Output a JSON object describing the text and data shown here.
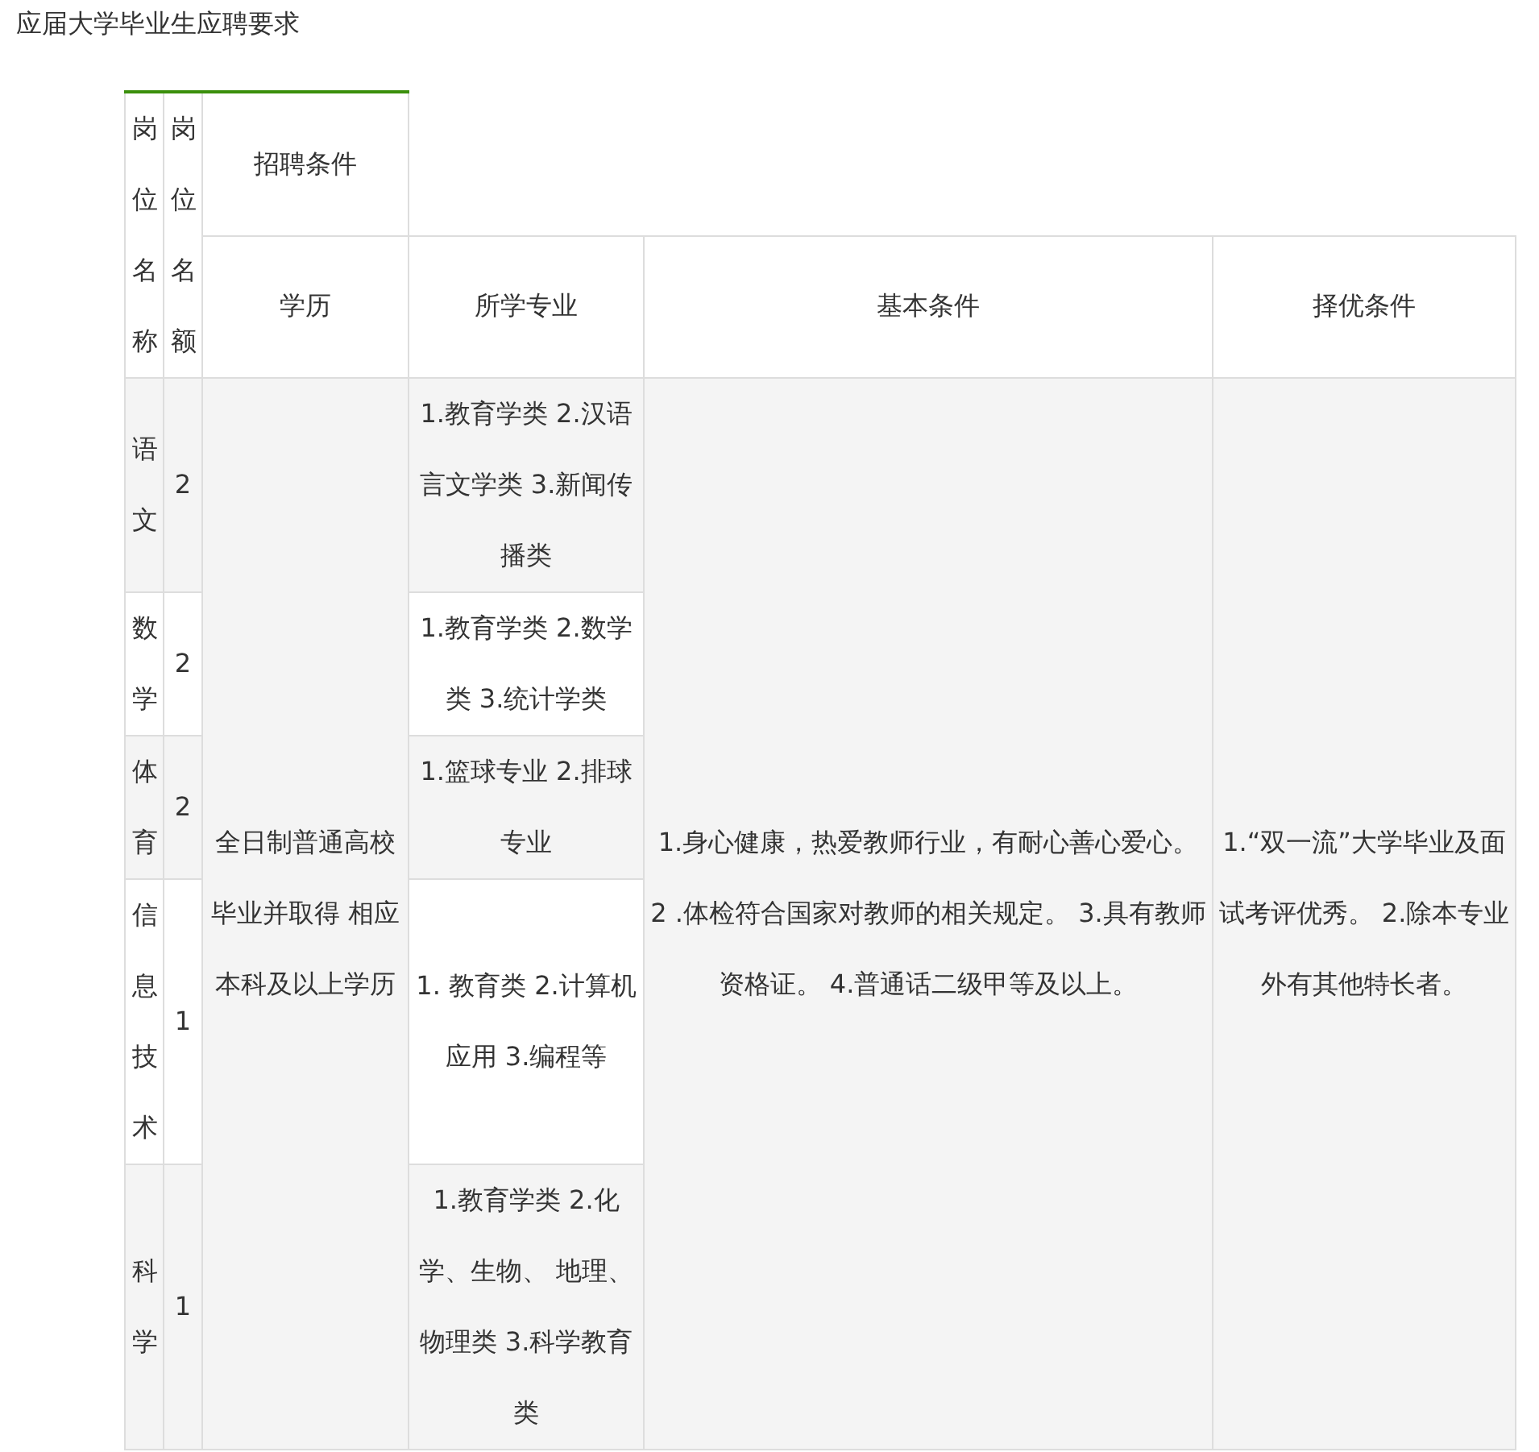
{
  "title": "应届大学毕业生应聘要求",
  "table": {
    "header": {
      "position_name": "岗位名称",
      "position_count": "岗位名额",
      "group": "招聘条件",
      "columns": [
        "学历",
        "所学专业",
        "基本条件",
        "择优条件"
      ]
    },
    "shared": {
      "education": "全日制普通高校毕业并取得 相应本科及以上学历",
      "basic": "1.身心健康，热爱教师行业，有耐心善心爱心。 2 .体检符合国家对教师的相关规定。 3.具有教师资格证。 4.普通话二级甲等及以上。",
      "preferred": "1.“双一流”大学毕业及面试考评优秀。 2.除本专业外有其他特长者。"
    },
    "rows": [
      {
        "position": "语文",
        "count": "2",
        "major": "1.教育学类 2.汉语言文学类 3.新闻传播类"
      },
      {
        "position": "数学",
        "count": "2",
        "major": "1.教育学类 2.数学类 3.统计学类"
      },
      {
        "position": "体育",
        "count": "2",
        "major": "1.篮球专业 2.排球专业"
      },
      {
        "position": "信息技术",
        "count": "1",
        "major": "1. 教育类 2.计算机应用 3.编程等"
      },
      {
        "position": "科学",
        "count": "1",
        "major": "1.教育学类 2.化学、生物、 地理、物理类 3.科学教育类"
      }
    ]
  }
}
